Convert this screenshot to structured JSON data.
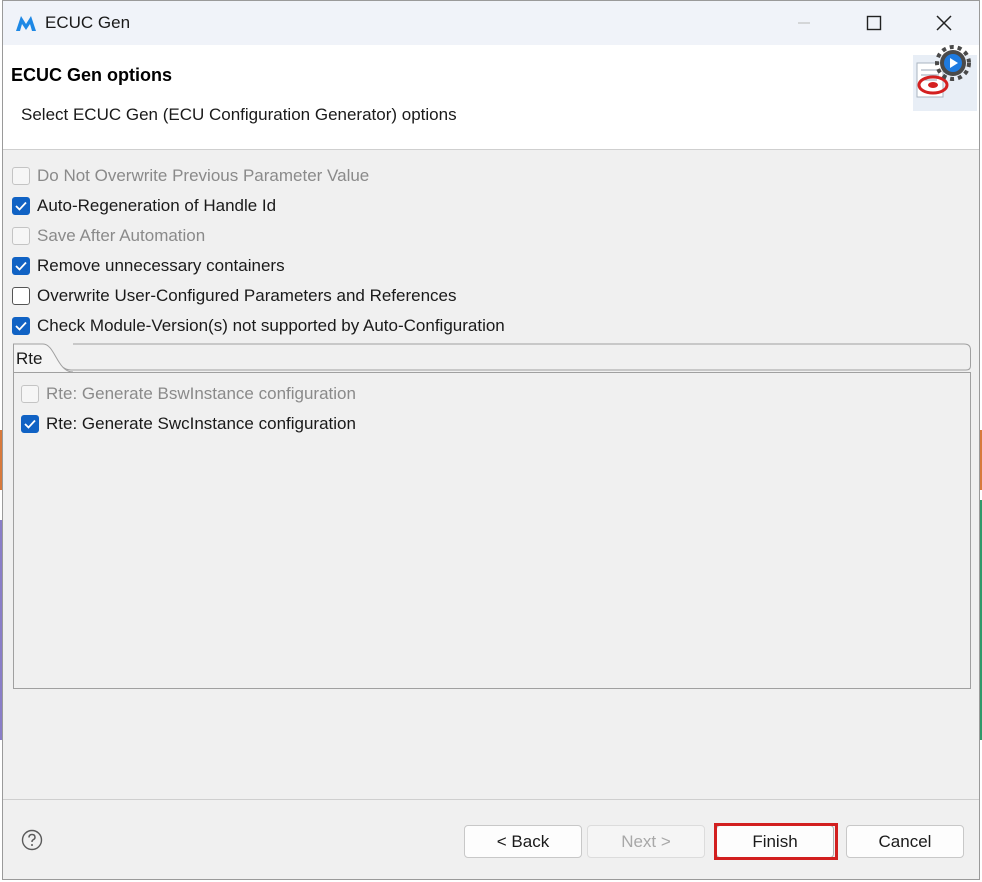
{
  "window": {
    "title": "ECUC Gen",
    "icon": "app-logo-icon"
  },
  "header": {
    "title": "ECUC Gen options",
    "description": "Select ECUC Gen (ECU Configuration Generator) options",
    "image_icon": "wizard-gear-icon"
  },
  "options": [
    {
      "label": "Do Not Overwrite Previous Parameter Value",
      "checked": false,
      "enabled": false
    },
    {
      "label": "Auto-Regeneration of Handle Id",
      "checked": true,
      "enabled": true
    },
    {
      "label": "Save After Automation",
      "checked": false,
      "enabled": false
    },
    {
      "label": "Remove unnecessary containers",
      "checked": true,
      "enabled": true
    },
    {
      "label": "Overwrite User-Configured Parameters and References",
      "checked": false,
      "enabled": true
    },
    {
      "label": "Check Module-Version(s) not supported by Auto-Configuration",
      "checked": true,
      "enabled": true
    }
  ],
  "tabs": {
    "active": "Rte",
    "items": [
      {
        "label": "Rte: Generate BswInstance configuration",
        "checked": false,
        "enabled": false
      },
      {
        "label": "Rte: Generate SwcInstance configuration",
        "checked": true,
        "enabled": true
      }
    ]
  },
  "footer": {
    "help_icon": "help-icon",
    "back": "< Back",
    "next": "Next >",
    "finish": "Finish",
    "cancel": "Cancel"
  },
  "colors": {
    "checkbox_checked": "#1062c4",
    "highlight": "#d21f1f"
  }
}
